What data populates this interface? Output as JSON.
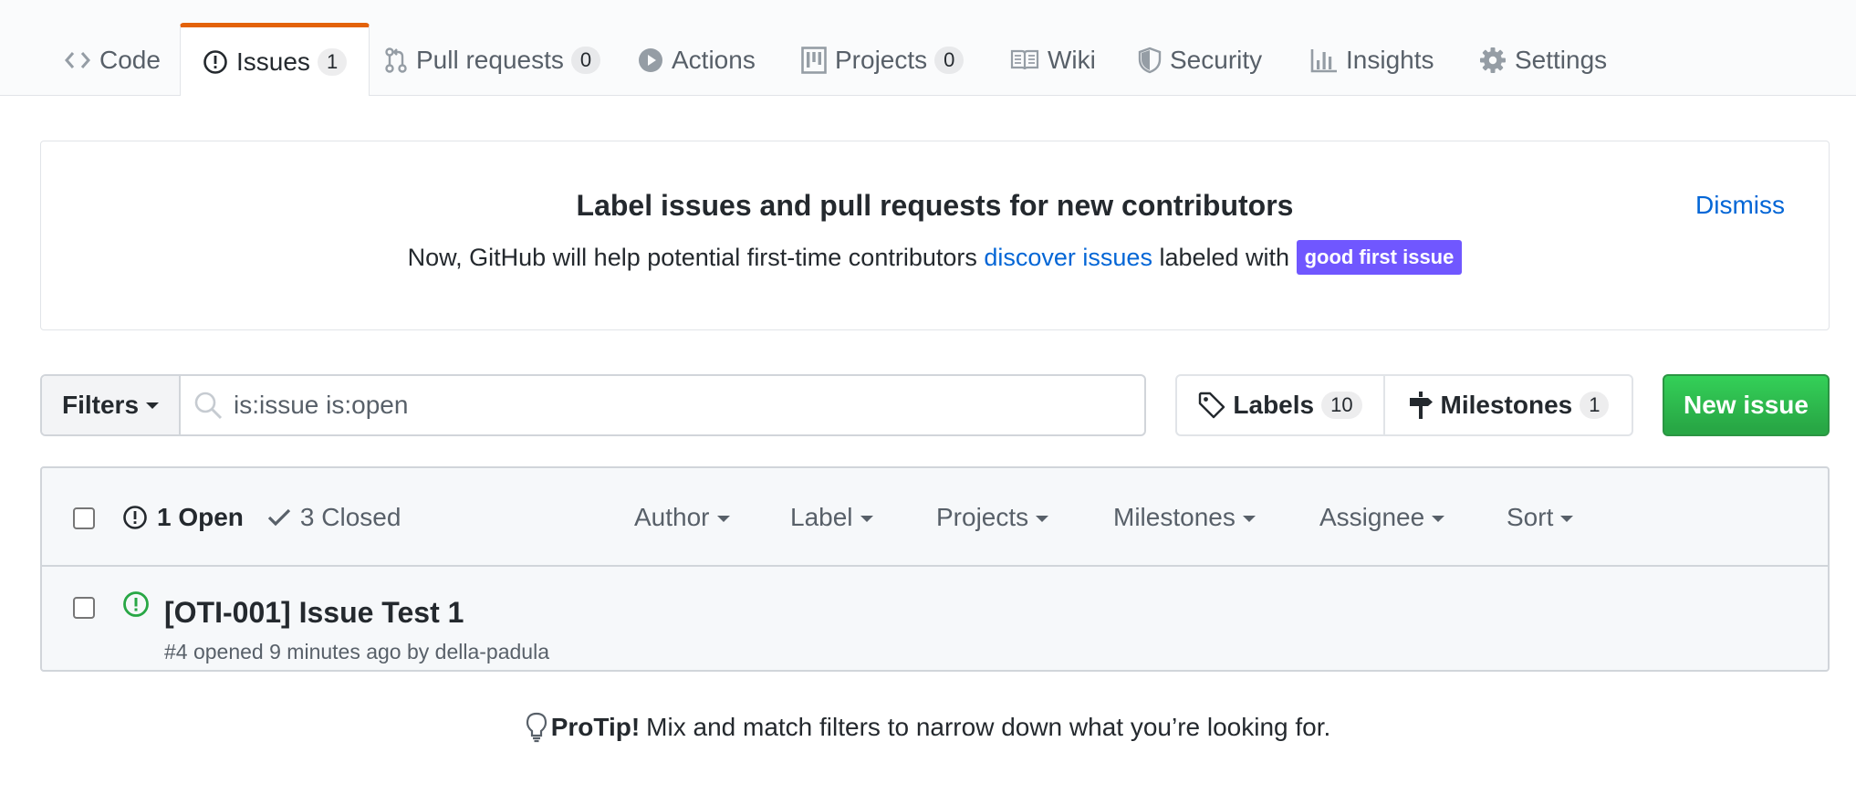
{
  "nav": {
    "tabs": [
      {
        "label": "Code",
        "icon": "code-icon"
      },
      {
        "label": "Issues",
        "icon": "issue-opened-icon",
        "counter": "1",
        "selected": true
      },
      {
        "label": "Pull requests",
        "icon": "git-pull-request-icon",
        "counter": "0"
      },
      {
        "label": "Actions",
        "icon": "play-icon"
      },
      {
        "label": "Projects",
        "icon": "project-icon",
        "counter": "0"
      },
      {
        "label": "Wiki",
        "icon": "book-icon"
      },
      {
        "label": "Security",
        "icon": "shield-icon"
      },
      {
        "label": "Insights",
        "icon": "graph-icon"
      },
      {
        "label": "Settings",
        "icon": "gear-icon"
      }
    ]
  },
  "banner": {
    "title": "Label issues and pull requests for new contributors",
    "text_before": "Now, GitHub will help potential first-time contributors ",
    "link": "discover issues",
    "text_after": " labeled with ",
    "label": "good first issue",
    "label_color": "#7057ff",
    "dismiss": "Dismiss"
  },
  "filters": {
    "button": "Filters",
    "search_value": "is:issue is:open"
  },
  "labels": {
    "label": "Labels",
    "count": "10"
  },
  "milestones": {
    "label": "Milestones",
    "count": "1"
  },
  "new_issue": {
    "label": "New issue",
    "color": "#2ea44f"
  },
  "list": {
    "open_label": "1 Open",
    "closed_label": "3 Closed",
    "menus": [
      "Author",
      "Label",
      "Projects",
      "Milestones",
      "Assignee",
      "Sort"
    ],
    "issues": [
      {
        "title": "[OTI-001] Issue Test 1",
        "meta": "#4 opened 9 minutes ago by della-padula",
        "state_color": "#28a745"
      }
    ]
  },
  "protip": {
    "strong": "ProTip!",
    "text": "Mix and match filters to narrow down what you’re looking for."
  }
}
